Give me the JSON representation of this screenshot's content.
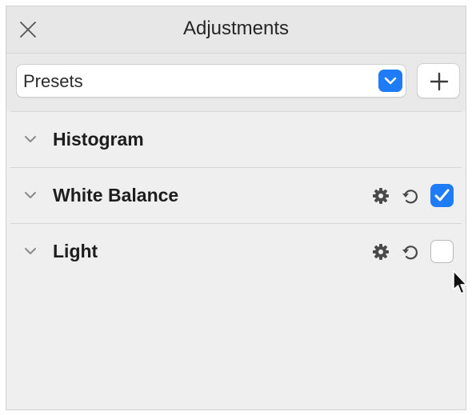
{
  "window": {
    "title": "Adjustments",
    "close_icon": "close-icon"
  },
  "presets": {
    "selected": "Presets",
    "add_icon": "plus-icon",
    "accent_color": "#1e7cf7"
  },
  "sections": [
    {
      "label": "Histogram",
      "has_actions": false
    },
    {
      "label": "White Balance",
      "has_actions": true,
      "enabled": true
    },
    {
      "label": "Light",
      "has_actions": true,
      "enabled": false
    }
  ]
}
